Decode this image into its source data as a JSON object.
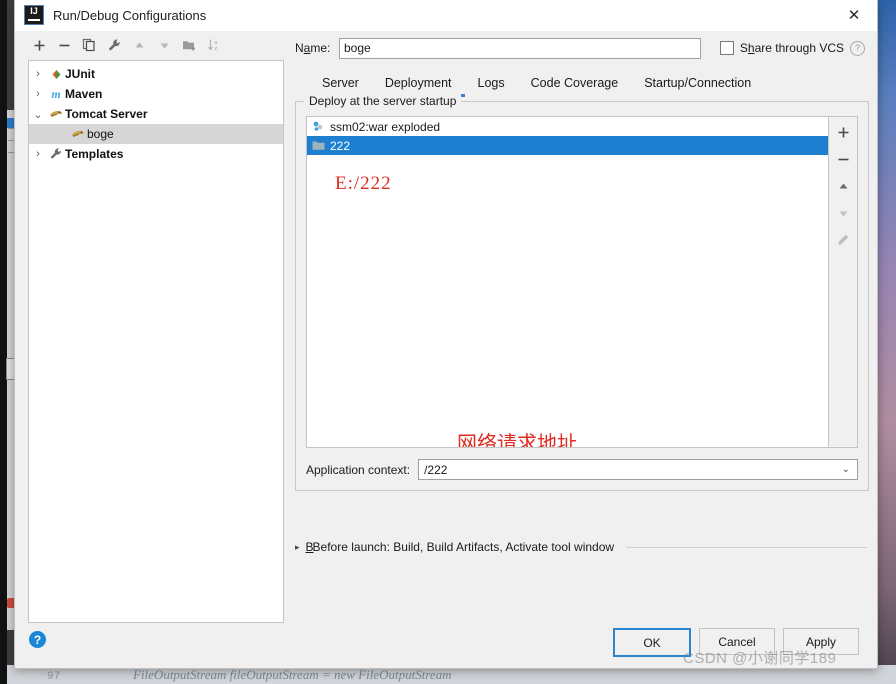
{
  "window": {
    "title": "Run/Debug Configurations",
    "app_icon": "intellij-idea-icon",
    "close_icon": "✕"
  },
  "toolbar": {
    "buttons": [
      {
        "name": "add-configuration-button",
        "label": "+",
        "enabled": true
      },
      {
        "name": "remove-configuration-button",
        "label": "−",
        "enabled": true
      },
      {
        "name": "copy-configuration-button",
        "label": "copy-icon",
        "enabled": true
      },
      {
        "name": "edit-templates-button",
        "label": "wrench-icon",
        "enabled": true
      },
      {
        "name": "move-up-button",
        "label": "▲",
        "enabled": false
      },
      {
        "name": "move-down-button",
        "label": "▼",
        "enabled": false
      },
      {
        "name": "new-folder-button",
        "label": "folder-add-icon",
        "enabled": false
      },
      {
        "name": "sort-alphabetically-button",
        "label": "sort-az-icon",
        "enabled": false
      }
    ]
  },
  "tree": {
    "nodes": [
      {
        "label": "JUnit",
        "icon": "junit-icon",
        "arrow": "›",
        "depth": 0,
        "bold": true,
        "selected": false
      },
      {
        "label": "Maven",
        "icon": "maven-icon",
        "arrow": "›",
        "depth": 0,
        "bold": true,
        "selected": false
      },
      {
        "label": "Tomcat Server",
        "icon": "tomcat-icon",
        "arrow": "⌄",
        "depth": 0,
        "bold": true,
        "selected": false
      },
      {
        "label": "boge",
        "icon": "tomcat-icon",
        "arrow": "",
        "depth": 1,
        "bold": false,
        "selected": true
      },
      {
        "label": "Templates",
        "icon": "wrench-icon",
        "arrow": "›",
        "depth": 0,
        "bold": true,
        "selected": false
      }
    ]
  },
  "name_field": {
    "label_pre": "N",
    "label_accel": "a",
    "label_post": "me:",
    "value": "boge",
    "placeholder": ""
  },
  "share_vcs": {
    "label_pre": "S",
    "label_accel": "h",
    "label_post": "are through VCS",
    "checked": false,
    "help_icon": "?"
  },
  "tabs": [
    {
      "label": "Server",
      "active": false
    },
    {
      "label": "Deployment",
      "active": true
    },
    {
      "label": "Logs",
      "active": false
    },
    {
      "label": "Code Coverage",
      "active": false
    },
    {
      "label": "Startup/Connection",
      "active": false
    }
  ],
  "deployment": {
    "group_title": "Deploy at the server startup",
    "items": [
      {
        "label": "ssm02:war exploded",
        "icon": "artifact-icon",
        "selected": false
      },
      {
        "label": "222",
        "icon": "folder-icon",
        "selected": true
      }
    ],
    "side_buttons": [
      {
        "name": "add-artifact-button",
        "label": "+",
        "enabled": true
      },
      {
        "name": "remove-artifact-button",
        "label": "−",
        "enabled": true
      },
      {
        "name": "move-up-artifact-button",
        "label": "▲",
        "enabled": true
      },
      {
        "name": "move-down-artifact-button",
        "label": "▼",
        "enabled": false
      },
      {
        "name": "edit-artifact-button",
        "label": "pencil-icon",
        "enabled": false
      }
    ],
    "annotations": {
      "path": "E:/222",
      "chinese_note": "网络请求地址",
      "color": "#e02b20"
    }
  },
  "application_context": {
    "label": "Application context:",
    "value": "/222",
    "arrow": "⌄"
  },
  "before_launch": {
    "arrow": "▸",
    "text_pre": "B",
    "text_accel": "B",
    "text": "Before launch: Build, Build Artifacts, Activate tool window"
  },
  "footer": {
    "help_label": "?",
    "buttons": [
      {
        "name": "ok-button",
        "label": "OK",
        "default": true
      },
      {
        "name": "cancel-button",
        "label": "Cancel",
        "default": false
      },
      {
        "name": "apply-button",
        "label": "Apply",
        "default": false
      }
    ]
  },
  "watermark": "CSDN @小谢同学189",
  "background": {
    "code_line": "FileOutputStream fileOutputStream = new FileOutputStream",
    "line_number": "97"
  },
  "colors": {
    "accent": "#2a85d0",
    "selection": "#1e7fd1",
    "tab_underline": "#3d7fd0",
    "annotation_red": "#e02b20",
    "dialog_bg": "#f0f0f0"
  }
}
